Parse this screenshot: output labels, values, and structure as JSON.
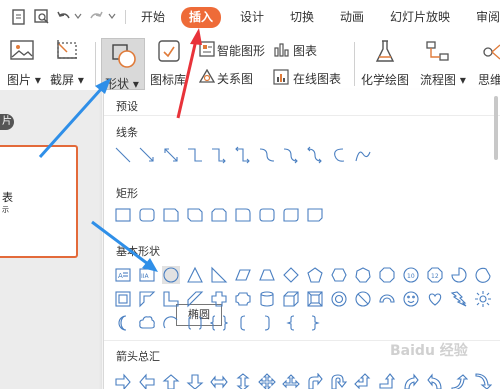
{
  "tabs": [
    {
      "label": "开始",
      "active": false
    },
    {
      "label": "插入",
      "active": true
    },
    {
      "label": "设计",
      "active": false
    },
    {
      "label": "切换",
      "active": false
    },
    {
      "label": "动画",
      "active": false
    },
    {
      "label": "幻灯片放映",
      "active": false
    },
    {
      "label": "审阅",
      "active": false
    }
  ],
  "ribbon": {
    "picture": "图片",
    "screenshot": "截屏",
    "shapes": "形状",
    "iconlib": "图标库",
    "smartart": "智能图形",
    "chart": "图表",
    "relation": "关系图",
    "online_chart": "在线图表",
    "chem": "化学绘图",
    "flow": "流程图",
    "mind": "思维"
  },
  "left_pane": {
    "tab": "片",
    "thumb_line1": "表",
    "thumb_line2": "示"
  },
  "dropdown": {
    "title": "预设",
    "sections": {
      "lines": "线条",
      "rect": "矩形",
      "basic": "基本形状",
      "arrows": "箭头总汇"
    },
    "tooltip": "椭圆"
  },
  "watermark": "Baidu 经验",
  "colors": {
    "accent": "#ee6b38",
    "annotation_blue": "#2f8fe8",
    "annotation_red": "#e8333a",
    "shape_stroke": "#4a7fc1"
  }
}
